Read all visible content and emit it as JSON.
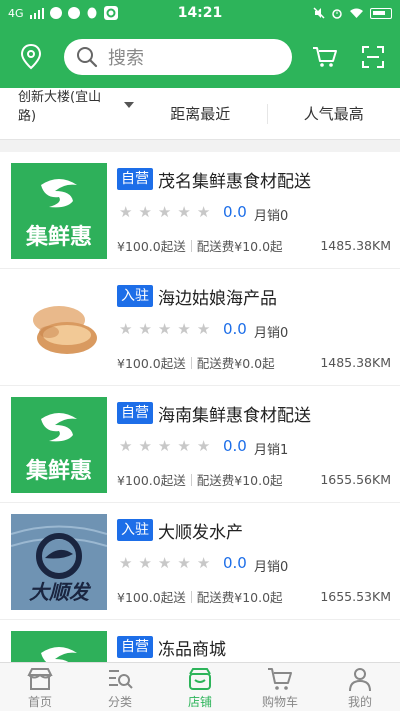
{
  "status_bar": {
    "network": "4G",
    "time": "14:21"
  },
  "header": {
    "search_placeholder": "搜索"
  },
  "filters": {
    "location": "创新大楼(宜山路)",
    "tabs": [
      "距离最近",
      "人气最高"
    ]
  },
  "stores": [
    {
      "badge": "自营",
      "name": "茂名集鲜惠食材配送",
      "rating": "0.0",
      "monthly_sales": "月销0",
      "min_order": "¥100.0起送",
      "delivery_fee": "配送费¥10.0起",
      "distance": "1485.38KM",
      "thumb": "jixianhui-logo",
      "logo_text": "集鲜惠"
    },
    {
      "badge": "入驻",
      "name": "海边姑娘海产品",
      "rating": "0.0",
      "monthly_sales": "月销0",
      "min_order": "¥100.0起送",
      "delivery_fee": "配送费¥0.0起",
      "distance": "1485.38KM",
      "thumb": "shellfish-photo",
      "logo_text": ""
    },
    {
      "badge": "自营",
      "name": "海南集鲜惠食材配送",
      "rating": "0.0",
      "monthly_sales": "月销1",
      "min_order": "¥100.0起送",
      "delivery_fee": "配送费¥10.0起",
      "distance": "1655.56KM",
      "thumb": "jixianhui-logo",
      "logo_text": "集鲜惠"
    },
    {
      "badge": "入驻",
      "name": "大顺发水产",
      "rating": "0.0",
      "monthly_sales": "月销0",
      "min_order": "¥100.0起送",
      "delivery_fee": "配送费¥10.0起",
      "distance": "1655.53KM",
      "thumb": "dashunfa-logo",
      "logo_text": "大顺发"
    },
    {
      "badge": "自营",
      "name": "冻品商城",
      "rating": "",
      "monthly_sales": "",
      "min_order": "",
      "delivery_fee": "",
      "distance": "",
      "thumb": "jixianhui-logo",
      "logo_text": ""
    }
  ],
  "tabbar": {
    "items": [
      {
        "label": "首页",
        "icon": "shop-icon",
        "active": false
      },
      {
        "label": "分类",
        "icon": "category-search-icon",
        "active": false
      },
      {
        "label": "店铺",
        "icon": "store-icon",
        "active": true
      },
      {
        "label": "购物车",
        "icon": "cart-icon",
        "active": false
      },
      {
        "label": "我的",
        "icon": "user-icon",
        "active": false
      }
    ]
  },
  "colors": {
    "brand_green": "#2db45a",
    "badge_blue": "#1d6ee8"
  }
}
